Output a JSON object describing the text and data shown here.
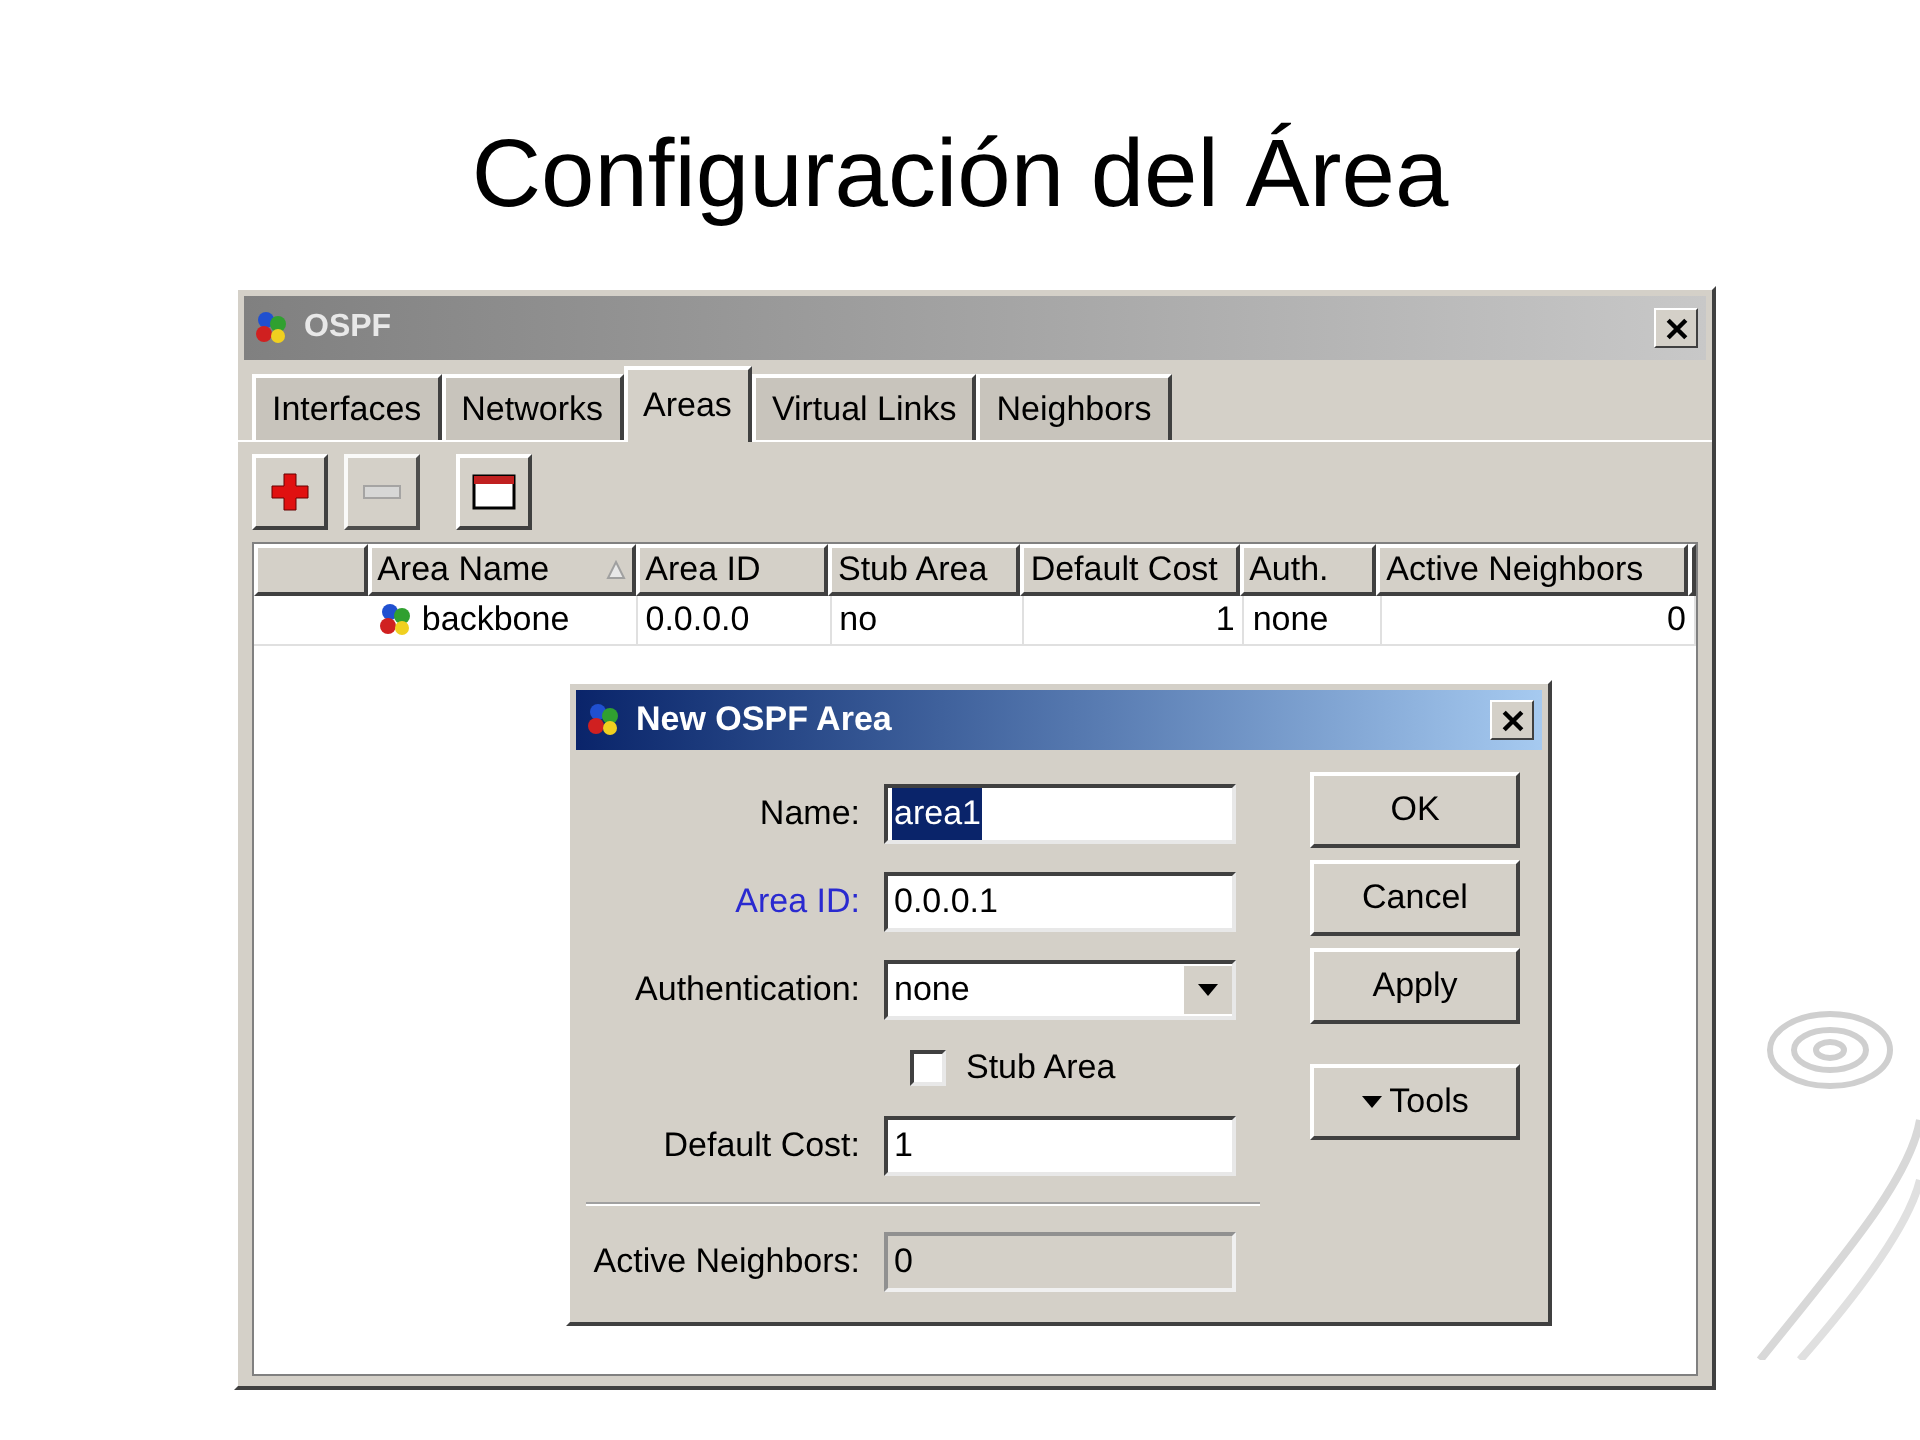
{
  "slide_title": "Configuración del Área",
  "ospf_window": {
    "title": "OSPF",
    "tabs": [
      {
        "label": "Interfaces",
        "selected": false
      },
      {
        "label": "Networks",
        "selected": false
      },
      {
        "label": "Areas",
        "selected": true
      },
      {
        "label": "Virtual Links",
        "selected": false
      },
      {
        "label": "Neighbors",
        "selected": false
      }
    ],
    "toolbar": [
      {
        "kind": "add",
        "disabled": false
      },
      {
        "kind": "remove",
        "disabled": true
      },
      {
        "kind": "window",
        "disabled": false
      }
    ],
    "table": {
      "columns": [
        {
          "label": "Area Name",
          "sorted": true
        },
        {
          "label": "Area ID",
          "sorted": false
        },
        {
          "label": "Stub Area",
          "sorted": false
        },
        {
          "label": "Default Cost",
          "sorted": false
        },
        {
          "label": "Auth.",
          "sorted": false
        },
        {
          "label": "Active Neighbors",
          "sorted": false
        }
      ],
      "rows": [
        {
          "cells": [
            "backbone",
            "0.0.0.0",
            "no",
            "1",
            "none",
            "0"
          ]
        }
      ]
    }
  },
  "dialog": {
    "title": "New OSPF Area",
    "fields": [
      {
        "kind": "text",
        "label": "Name:",
        "value": "area1",
        "selected": true,
        "highlighted": false
      },
      {
        "kind": "text",
        "label": "Area ID:",
        "value": "0.0.0.1",
        "selected": false,
        "highlighted": true
      },
      {
        "kind": "select",
        "label": "Authentication:",
        "value": "none",
        "highlighted": false
      },
      {
        "kind": "checkbox",
        "label": "Stub Area",
        "checked": false
      },
      {
        "kind": "text",
        "label": "Default Cost:",
        "value": "1",
        "selected": false,
        "highlighted": false
      },
      {
        "kind": "separator"
      },
      {
        "kind": "readonly",
        "label": "Active Neighbors:",
        "value": "0",
        "highlighted": false
      }
    ],
    "buttons": [
      {
        "kind": "button",
        "label": "OK"
      },
      {
        "kind": "button",
        "label": "Cancel"
      },
      {
        "kind": "button",
        "label": "Apply"
      },
      {
        "kind": "menu",
        "label": "Tools"
      }
    ]
  }
}
